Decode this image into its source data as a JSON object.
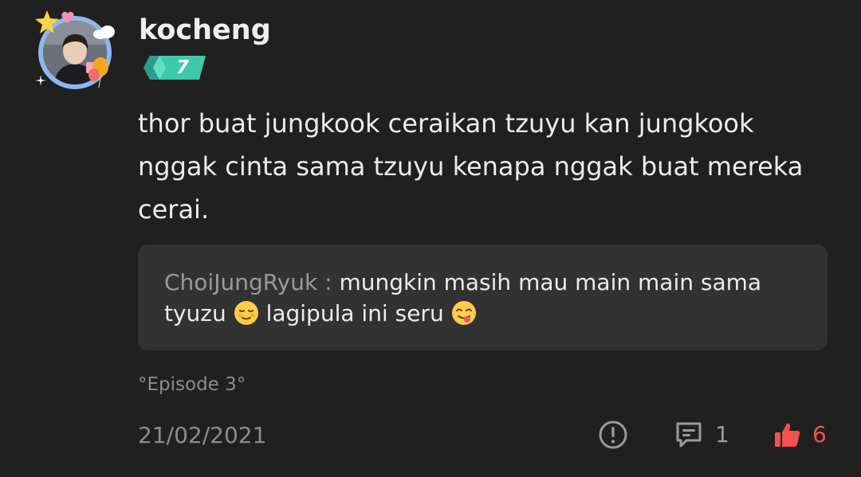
{
  "comment": {
    "username": "kocheng",
    "level": "7",
    "text": "thor buat jungkook ceraikan tzuyu kan jungkook nggak cinta sama tzuyu kenapa nggak buat mereka cerai.",
    "reply": {
      "author": "ChoiJungRyuk :",
      "text_part1": "mungkin masih mau main main sama tyuzu",
      "text_part2": "lagipula ini seru"
    },
    "episode": "°Episode 3°",
    "date": "21/02/2021",
    "reply_count": "1",
    "like_count": "6"
  },
  "colors": {
    "background": "#202020",
    "reply_background": "#323232",
    "like_accent": "#f0524d",
    "level_badge": "#3ec9ad",
    "muted_text": "#8c8c8c"
  },
  "icons": {
    "report": "exclamation-circle-icon",
    "reply": "comment-bubble-icon",
    "like": "thumbs-up-icon",
    "emoji1": "relieved-face-emoji",
    "emoji2": "yum-face-emoji"
  }
}
